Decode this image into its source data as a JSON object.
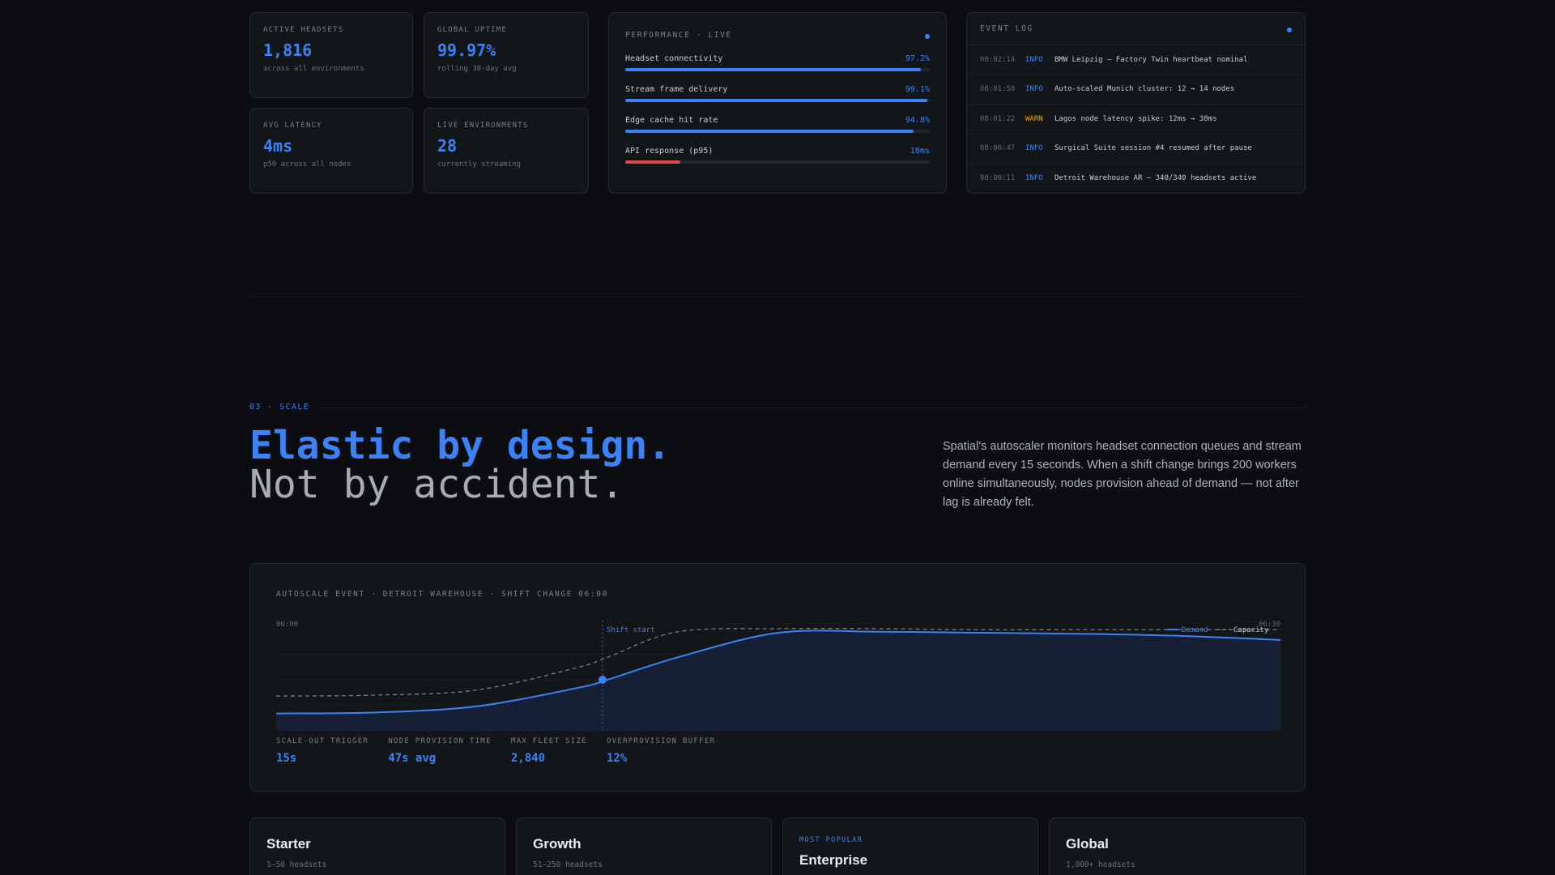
{
  "stats": [
    {
      "label": "ACTIVE HEADSETS",
      "value": "1,816",
      "sub": "across all environments"
    },
    {
      "label": "GLOBAL UPTIME",
      "value": "99.97%",
      "sub": "rolling 30-day avg"
    },
    {
      "label": "AVG LATENCY",
      "value": "4ms",
      "sub": "p50 across all nodes"
    },
    {
      "label": "LIVE ENVIRONMENTS",
      "value": "28",
      "sub": "currently streaming"
    }
  ],
  "performance": {
    "title": "PERFORMANCE · LIVE",
    "metrics": [
      {
        "label": "Headset connectivity",
        "value": "97.2%",
        "fill": 0.972
      },
      {
        "label": "Stream frame delivery",
        "value": "99.1%",
        "fill": 0.991
      },
      {
        "label": "Edge cache hit rate",
        "value": "94.8%",
        "fill": 0.948
      },
      {
        "label": "API response (p95)",
        "value": "18ms",
        "fill": 0.18
      }
    ]
  },
  "event_log": {
    "title": "EVENT LOG",
    "rows": [
      {
        "time": "08:02:14",
        "level": "INFO",
        "message": "BMW Leipzig — Factory Twin heartbeat nominal"
      },
      {
        "time": "08:01:58",
        "level": "INFO",
        "message": "Auto-scaled Munich cluster: 12 → 14 nodes"
      },
      {
        "time": "08:01:22",
        "level": "WARN",
        "message": "Lagos node latency spike: 12ms → 38ms"
      },
      {
        "time": "08:00:47",
        "level": "INFO",
        "message": "Surgical Suite session #4 resumed after pause"
      },
      {
        "time": "08:00:11",
        "level": "INFO",
        "message": "Detroit Warehouse AR — 340/340 headsets active"
      }
    ]
  },
  "section": {
    "eyebrow": "03 · SCALE",
    "headline_a": "Elastic by design.",
    "headline_b": "Not by accident.",
    "lede": "Spatial's autoscaler monitors headset connection queues and stream demand every 15 seconds. When a shift change brings 200 workers online simultaneously, nodes provision ahead of demand — not after lag is already felt."
  },
  "autoscale": {
    "title": "AUTOSCALE EVENT · DETROIT WAREHOUSE · SHIFT CHANGE 06:00",
    "stats": [
      {
        "label": "SCALE-OUT TRIGGER",
        "value": "15s"
      },
      {
        "label": "NODE PROVISION TIME",
        "value": "47s avg"
      },
      {
        "label": "MAX FLEET SIZE",
        "value": "2,840"
      },
      {
        "label": "OVERPROVISION BUFFER",
        "value": "12%"
      }
    ]
  },
  "chart_data": {
    "type": "area",
    "x": [
      0,
      0.1,
      0.2,
      0.3,
      0.33,
      0.4,
      0.5,
      0.6,
      0.7,
      0.8,
      0.9,
      1.0
    ],
    "x_tick_labels": [
      {
        "x": 0,
        "label": "06:00"
      },
      {
        "x": 1,
        "label": "06:30"
      }
    ],
    "series": [
      {
        "name": "Demand",
        "style": "solid-filled",
        "color": "#3b82f6",
        "values": [
          0.17,
          0.18,
          0.24,
          0.42,
          0.5,
          0.72,
          0.96,
          0.97,
          0.96,
          0.95,
          0.93,
          0.89
        ]
      },
      {
        "name": "Capacity",
        "style": "dashed",
        "color": "#7a7f87",
        "values": [
          0.34,
          0.35,
          0.4,
          0.62,
          0.72,
          0.97,
          1.0,
          1.0,
          0.99,
          0.99,
          0.99,
          0.99
        ]
      }
    ],
    "annotations": [
      {
        "x": 0.325,
        "label": "Shift start"
      }
    ],
    "marker": {
      "x": 0.325,
      "value": 0.5
    },
    "legend": "top-right",
    "ylim": [
      0,
      1
    ],
    "grid": true
  },
  "plans": [
    {
      "badge": "",
      "name": "Starter",
      "range": "1–50 headsets"
    },
    {
      "badge": "",
      "name": "Growth",
      "range": "51–250 headsets"
    },
    {
      "badge": "MOST POPULAR",
      "name": "Enterprise",
      "range": ""
    },
    {
      "badge": "",
      "name": "Global",
      "range": "1,000+ headsets"
    }
  ],
  "colors": {
    "accent": "#3b82f6",
    "warn": "#f59e0b",
    "danger": "#e0474c",
    "bg": "#0b0d10",
    "card": "#131619"
  }
}
